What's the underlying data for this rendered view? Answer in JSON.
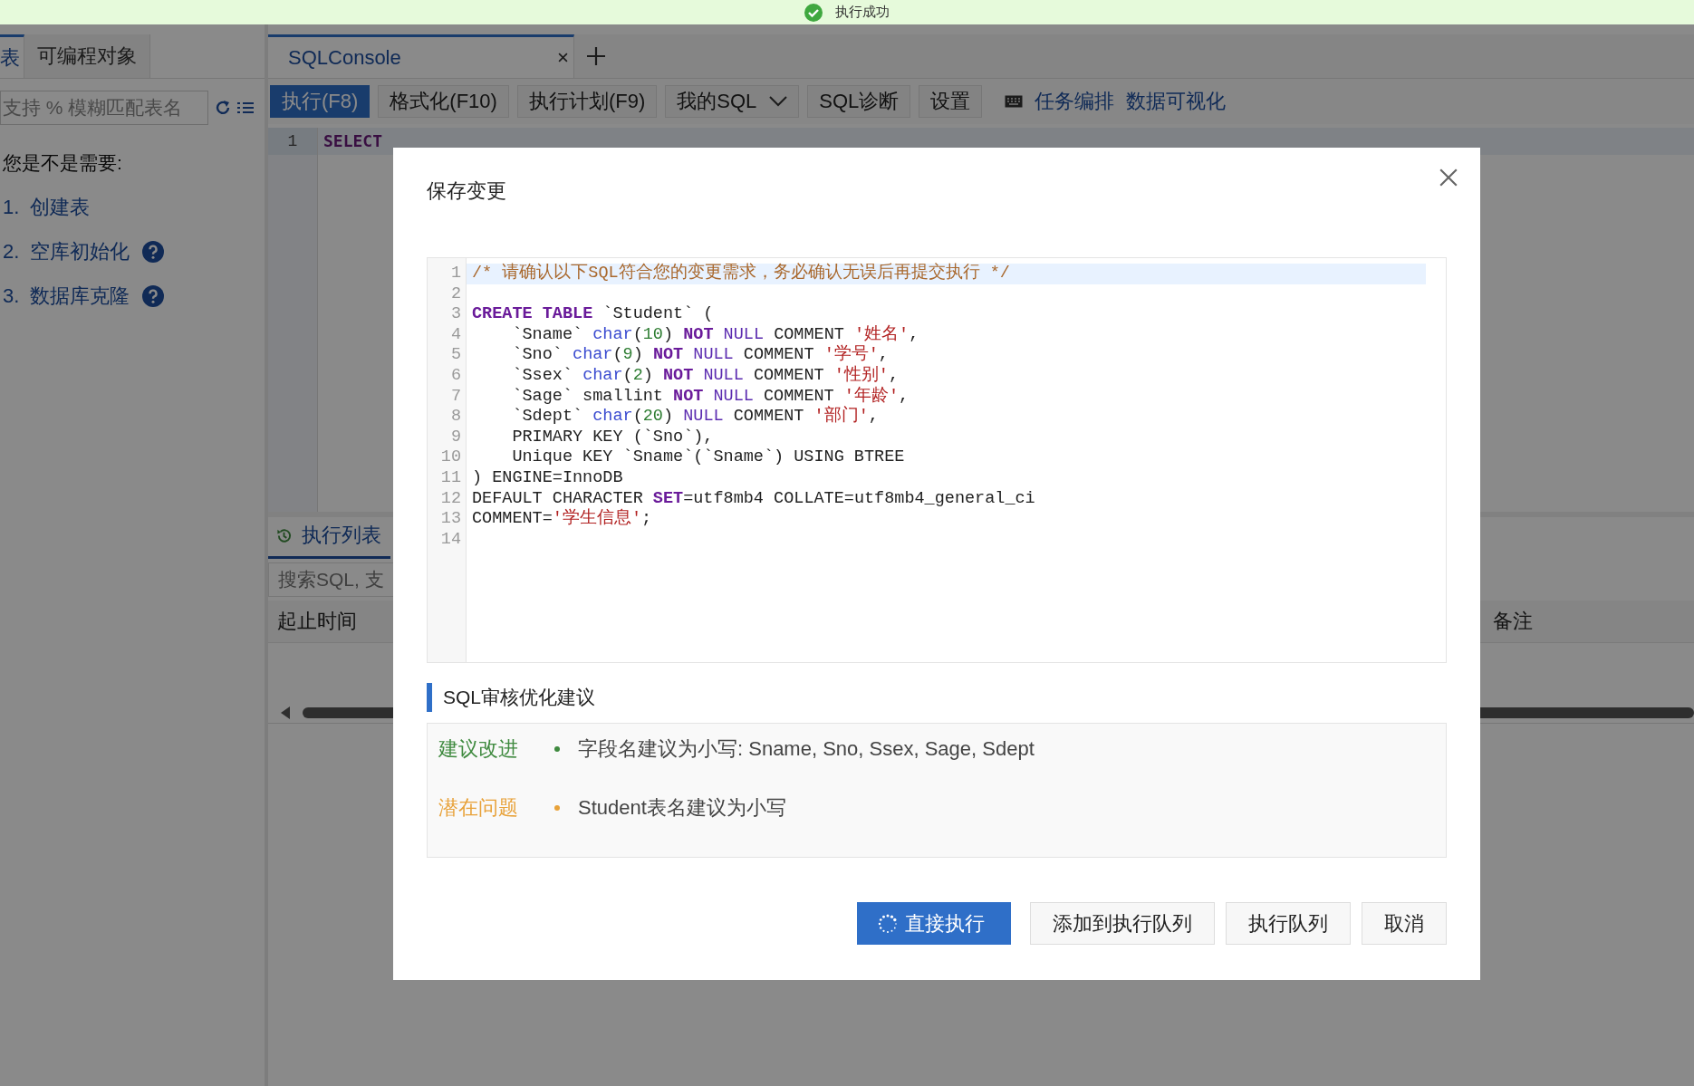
{
  "toast": {
    "text": "执行成功"
  },
  "left_panel": {
    "tabs": [
      {
        "label": "表",
        "selected": true
      },
      {
        "label": "可编程对象",
        "selected": false
      }
    ],
    "search": {
      "placeholder": "支持 % 模糊匹配表名"
    },
    "hint_title": "您是不是需要:",
    "hints": [
      {
        "number": "1.",
        "text": "创建表",
        "help": false
      },
      {
        "number": "2.",
        "text": "空库初始化",
        "help": true
      },
      {
        "number": "3.",
        "text": "数据库克隆",
        "help": true
      }
    ]
  },
  "editor_tabs": [
    {
      "label": "SQLConsole",
      "selected": true
    }
  ],
  "toolbar": [
    {
      "label": "执行(F8)",
      "kind": "primary"
    },
    {
      "label": "格式化(F10)",
      "kind": "default"
    },
    {
      "label": "执行计划(F9)",
      "kind": "default"
    },
    {
      "label": "我的SQL",
      "kind": "dropdown"
    },
    {
      "label": "SQL诊断",
      "kind": "default"
    },
    {
      "label": "设置",
      "kind": "default"
    },
    {
      "label": "任务编排",
      "kind": "link"
    },
    {
      "label": "数据可视化",
      "kind": "link"
    }
  ],
  "editor": {
    "line_number": "1",
    "text": "SELECT"
  },
  "exec_panel": {
    "tab": "执行列表",
    "search": {
      "placeholder": "搜索SQL, 支"
    },
    "columns": [
      "起止时间",
      "备注"
    ]
  },
  "dialog": {
    "title": "保存变更",
    "code": [
      {
        "number": "1",
        "highlighted": true,
        "tokens": [
          {
            "text": "/* 请确认以下SQL符合您的变更需求，务必确认无误后再提交执行 */",
            "kind": "comment"
          }
        ]
      },
      {
        "number": "2",
        "highlighted": false
      },
      {
        "number": "3",
        "highlighted": false,
        "tokens": [
          {
            "text": "CREATE",
            "kind": "keyword"
          },
          {
            "text": " TABLE",
            "kind": "keyword"
          },
          {
            "text": " `Student` (",
            "kind": "plain"
          }
        ]
      },
      {
        "number": "4",
        "highlighted": false,
        "tokens": [
          {
            "text": "    `Sname` ",
            "kind": "plain"
          },
          {
            "text": "char",
            "kind": "type"
          },
          {
            "text": "(",
            "kind": "plain"
          },
          {
            "text": "10",
            "kind": "number"
          },
          {
            "text": ") ",
            "kind": "plain"
          },
          {
            "text": "NOT",
            "kind": "keyword"
          },
          {
            "text": " NULL",
            "kind": "atom"
          },
          {
            "text": " COMMENT ",
            "kind": "plain"
          },
          {
            "text": "'姓名'",
            "kind": "string"
          },
          {
            "text": ",",
            "kind": "plain"
          }
        ]
      },
      {
        "number": "5",
        "highlighted": false,
        "tokens": [
          {
            "text": "    `Sno` ",
            "kind": "plain"
          },
          {
            "text": "char",
            "kind": "type"
          },
          {
            "text": "(",
            "kind": "plain"
          },
          {
            "text": "9",
            "kind": "number"
          },
          {
            "text": ") ",
            "kind": "plain"
          },
          {
            "text": "NOT",
            "kind": "keyword"
          },
          {
            "text": " NULL",
            "kind": "atom"
          },
          {
            "text": " COMMENT ",
            "kind": "plain"
          },
          {
            "text": "'学号'",
            "kind": "string"
          },
          {
            "text": ",",
            "kind": "plain"
          }
        ]
      },
      {
        "number": "6",
        "highlighted": false,
        "tokens": [
          {
            "text": "    `Ssex` ",
            "kind": "plain"
          },
          {
            "text": "char",
            "kind": "type"
          },
          {
            "text": "(",
            "kind": "plain"
          },
          {
            "text": "2",
            "kind": "number"
          },
          {
            "text": ") ",
            "kind": "plain"
          },
          {
            "text": "NOT",
            "kind": "keyword"
          },
          {
            "text": " NULL",
            "kind": "atom"
          },
          {
            "text": " COMMENT ",
            "kind": "plain"
          },
          {
            "text": "'性别'",
            "kind": "string"
          },
          {
            "text": ",",
            "kind": "plain"
          }
        ]
      },
      {
        "number": "7",
        "highlighted": false,
        "tokens": [
          {
            "text": "    `Sage` smallint ",
            "kind": "plain"
          },
          {
            "text": "NOT",
            "kind": "keyword"
          },
          {
            "text": " NULL",
            "kind": "atom"
          },
          {
            "text": " COMMENT ",
            "kind": "plain"
          },
          {
            "text": "'年龄'",
            "kind": "string"
          },
          {
            "text": ",",
            "kind": "plain"
          }
        ]
      },
      {
        "number": "8",
        "highlighted": false,
        "tokens": [
          {
            "text": "    `Sdept` ",
            "kind": "plain"
          },
          {
            "text": "char",
            "kind": "type"
          },
          {
            "text": "(",
            "kind": "plain"
          },
          {
            "text": "20",
            "kind": "number"
          },
          {
            "text": ") ",
            "kind": "plain"
          },
          {
            "text": "NULL",
            "kind": "atom"
          },
          {
            "text": " COMMENT ",
            "kind": "plain"
          },
          {
            "text": "'部门'",
            "kind": "string"
          },
          {
            "text": ",",
            "kind": "plain"
          }
        ]
      },
      {
        "number": "9",
        "highlighted": false,
        "tokens": [
          {
            "text": "    PRIMARY KEY (`Sno`),",
            "kind": "plain"
          }
        ]
      },
      {
        "number": "10",
        "highlighted": false,
        "tokens": [
          {
            "text": "    Unique KEY `Sname`(`Sname`) USING BTREE",
            "kind": "plain"
          }
        ]
      },
      {
        "number": "11",
        "highlighted": false,
        "tokens": [
          {
            "text": ") ENGINE=InnoDB",
            "kind": "plain"
          }
        ]
      },
      {
        "number": "12",
        "highlighted": false,
        "tokens": [
          {
            "text": "DEFAULT CHARACTER ",
            "kind": "plain"
          },
          {
            "text": "SET",
            "kind": "keyword"
          },
          {
            "text": "=utf8mb4 COLLATE=utf8mb4_general_ci",
            "kind": "plain"
          }
        ]
      },
      {
        "number": "13",
        "highlighted": false,
        "tokens": [
          {
            "text": "COMMENT=",
            "kind": "plain"
          },
          {
            "text": "'学生信息'",
            "kind": "string"
          },
          {
            "text": ";",
            "kind": "plain"
          }
        ]
      },
      {
        "number": "14",
        "highlighted": false
      }
    ],
    "review_title": "SQL审核优化建议",
    "suggestions": [
      {
        "label": "建议改进",
        "color": "#3f8a3f",
        "text": "字段名建议为小写: Sname, Sno, Ssex, Sage, Sdept"
      },
      {
        "label": "潜在问题",
        "color": "#e8a23a",
        "text": "Student表名建议为小写"
      }
    ],
    "buttons": [
      {
        "label": "直接执行",
        "kind": "primary",
        "loading": true
      },
      {
        "label": "添加到执行队列",
        "kind": "default",
        "loading": false
      },
      {
        "label": "执行队列",
        "kind": "default",
        "loading": false
      },
      {
        "label": "取消",
        "kind": "default",
        "loading": false
      }
    ]
  }
}
